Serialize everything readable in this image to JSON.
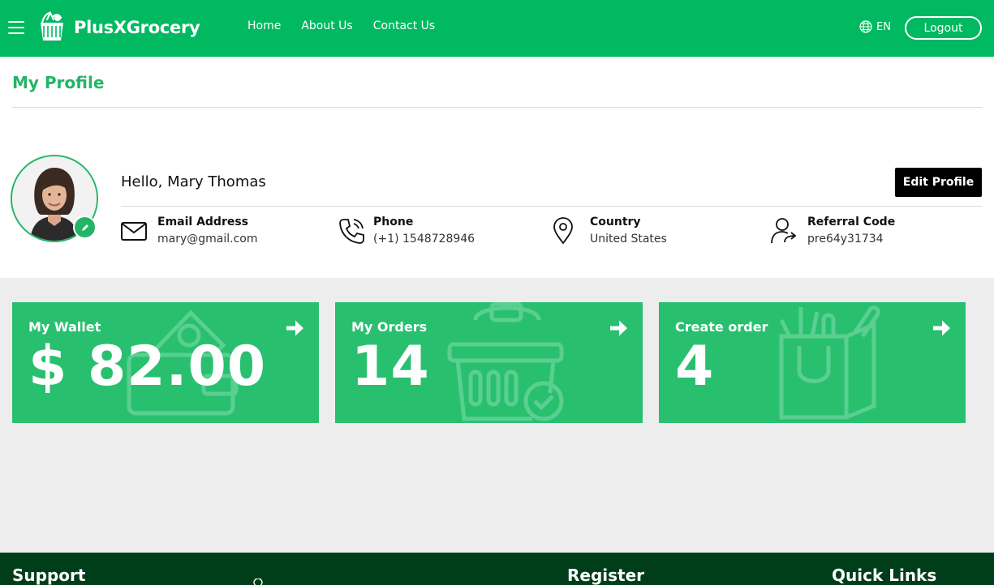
{
  "navbar": {
    "brand": "PlusXGrocery",
    "links": [
      "Home",
      "About Us",
      "Contact Us"
    ],
    "language": "EN",
    "logout_label": "Logout",
    "bg_color": "#00b960"
  },
  "profile": {
    "page_title": "My Profile",
    "greeting": "Hello, Mary Thomas",
    "edit_label": "Edit Profile",
    "info": [
      {
        "icon": "mail-icon",
        "label": "Email Address",
        "value": "mary@gmail.com"
      },
      {
        "icon": "phone-icon",
        "label": "Phone",
        "value": "(+1) 1548728946"
      },
      {
        "icon": "location-pin-icon",
        "label": "Country",
        "value": "United States"
      },
      {
        "icon": "user-share-icon",
        "label": "Referral Code",
        "value": "pre64y31734"
      }
    ]
  },
  "cards": [
    {
      "title": "My Wallet",
      "value": "$ 82.00",
      "icon": "wallet-icon"
    },
    {
      "title": "My Orders",
      "value": "14",
      "icon": "basket-icon"
    },
    {
      "title": "Create order",
      "value": "4",
      "icon": "grocery-bag-icon"
    }
  ],
  "footer": {
    "support": "Support",
    "register": "Register",
    "quick_links": "Quick Links"
  },
  "colors": {
    "accent": "#22b566",
    "card": "#28c06f",
    "footer": "#003d19"
  }
}
